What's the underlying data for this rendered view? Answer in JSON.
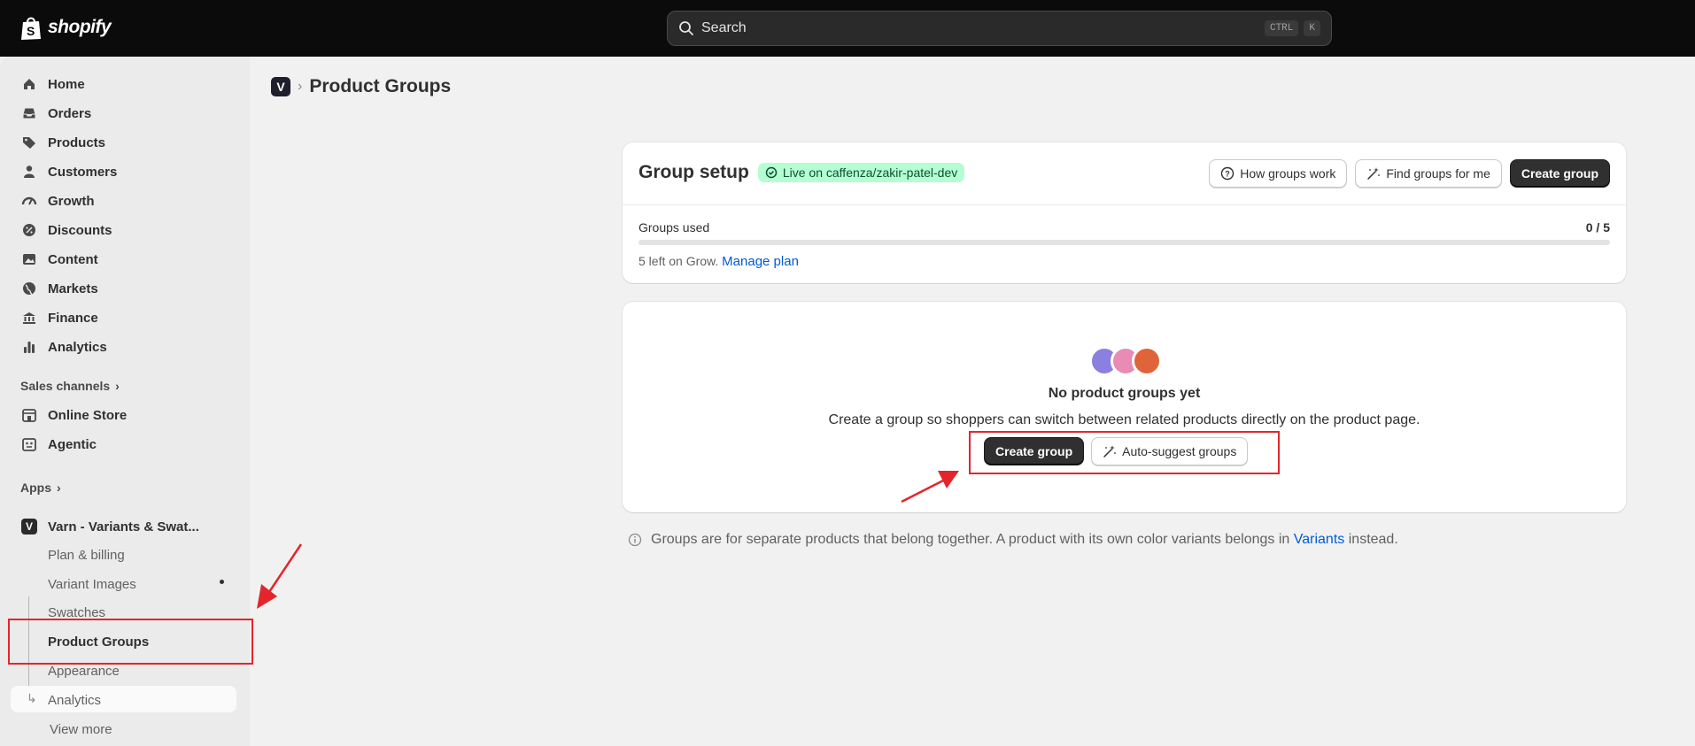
{
  "brand": {
    "name": "shopify"
  },
  "search": {
    "placeholder": "Search",
    "kbd1": "CTRL",
    "kbd2": "K"
  },
  "sidebar": {
    "items": [
      {
        "label": "Home",
        "icon": "home-icon"
      },
      {
        "label": "Orders",
        "icon": "inbox-icon"
      },
      {
        "label": "Products",
        "icon": "tag-icon"
      },
      {
        "label": "Customers",
        "icon": "person-icon"
      },
      {
        "label": "Growth",
        "icon": "gauge-icon"
      },
      {
        "label": "Discounts",
        "icon": "discount-icon"
      },
      {
        "label": "Content",
        "icon": "image-icon"
      },
      {
        "label": "Markets",
        "icon": "globe-icon"
      },
      {
        "label": "Finance",
        "icon": "bank-icon"
      },
      {
        "label": "Analytics",
        "icon": "bar-chart-icon"
      }
    ],
    "sales_channels_label": "Sales channels",
    "channels": [
      {
        "label": "Online Store",
        "icon": "store-icon"
      },
      {
        "label": "Agentic",
        "icon": "robot-icon"
      }
    ],
    "apps_label": "Apps",
    "app": {
      "label": "Varn - Variants & Swat...",
      "subitems": [
        "Plan & billing",
        "Variant Images",
        "Swatches",
        "Product Groups",
        "Appearance",
        "Analytics"
      ],
      "active": "Product Groups",
      "view_more": "View more"
    }
  },
  "breadcrumb": {
    "title": "Product Groups"
  },
  "setup": {
    "title": "Group setup",
    "badge": "Live on caffenza/zakir-patel-dev",
    "how_label": "How groups work",
    "find_label": "Find groups for me",
    "create_label": "Create group",
    "usage_label": "Groups used",
    "usage_value": "0 / 5",
    "usage_fraction": 0,
    "plan_note": "5 left on Grow.",
    "plan_link": "Manage plan"
  },
  "empty": {
    "title": "No product groups yet",
    "description": "Create a group so shoppers can switch between related products directly on the product page.",
    "create_label": "Create group",
    "suggest_label": "Auto-suggest groups"
  },
  "info": {
    "text": "Groups are for separate products that belong together. A product with its own color variants belongs in",
    "link": "Variants",
    "suffix": "instead."
  },
  "colors": {
    "avatar1": "#8b7fe0",
    "avatar2": "#e88cb4",
    "avatar3": "#e0643a",
    "annotation": "#e3262b",
    "link": "#005bd3"
  }
}
